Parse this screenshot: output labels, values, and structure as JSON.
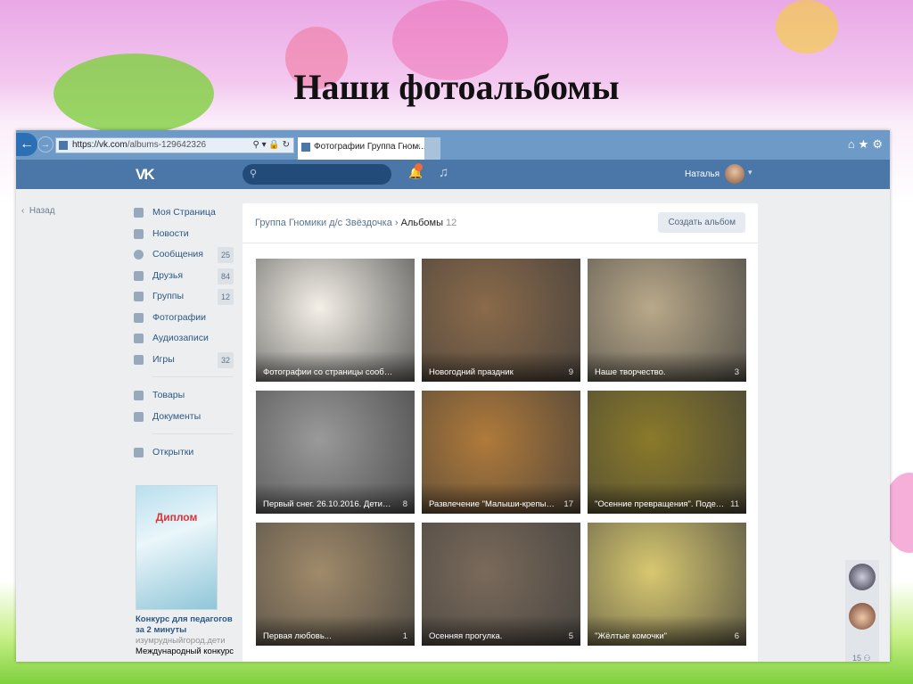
{
  "slide": {
    "title": "Наши фотоальбомы"
  },
  "browser": {
    "url_host": "https://vk.com",
    "url_path": "/albums-129642326",
    "tab_title": "Фотографии Группа Гном...",
    "tab_close": "×",
    "tools": "⌂★⚙"
  },
  "header": {
    "logo": "VK",
    "user_name": "Наталья",
    "notification_count": "1"
  },
  "back": {
    "label": "Назад"
  },
  "menu": {
    "items": [
      {
        "label": "Моя Страница"
      },
      {
        "label": "Новости"
      },
      {
        "label": "Сообщения",
        "count": "25"
      },
      {
        "label": "Друзья",
        "count": "84"
      },
      {
        "label": "Группы",
        "count": "12"
      },
      {
        "label": "Фотографии"
      },
      {
        "label": "Аудиозаписи"
      },
      {
        "label": "Игры",
        "count": "32"
      },
      {
        "label": "Товары"
      },
      {
        "label": "Документы"
      },
      {
        "label": "Открытки"
      }
    ]
  },
  "ad": {
    "image_text": "Диплом",
    "title": "Конкурс для педагогов за 2 минуты",
    "domain": "изумрудныйгород.дети",
    "desc": "Международный конкурс"
  },
  "content": {
    "breadcrumb_group": "Группа Гномики д/с Звёздочка",
    "breadcrumb_sep": "›",
    "breadcrumb_current": "Альбомы",
    "album_total": "12",
    "create_button": "Создать альбом",
    "albums": [
      {
        "name": "Фотографии со страницы сообщ...",
        "count": "",
        "color": "#f4f0e8"
      },
      {
        "name": "Новогодний праздник",
        "count": "9",
        "color": "#8a6a4a"
      },
      {
        "name": "Наше творчество.",
        "count": "3",
        "color": "#b9a98a"
      },
      {
        "name": "Первый снег. 26.10.2016. Дети б...",
        "count": "8",
        "color": "#9a9a9a"
      },
      {
        "name": "Развлечение \"Малыши-крепыш...",
        "count": "17",
        "color": "#b07a3a"
      },
      {
        "name": "\"Осенние превращения\". Подел...",
        "count": "11",
        "color": "#8a7a2a"
      },
      {
        "name": "Первая любовь...",
        "count": "1",
        "color": "#a08a6a"
      },
      {
        "name": "Осенняя прогулка.",
        "count": "5",
        "color": "#7a6a5a"
      },
      {
        "name": "\"Жёлтые комочки\"",
        "count": "6",
        "color": "#d8c870"
      }
    ]
  },
  "chat": {
    "online_count": "15"
  }
}
